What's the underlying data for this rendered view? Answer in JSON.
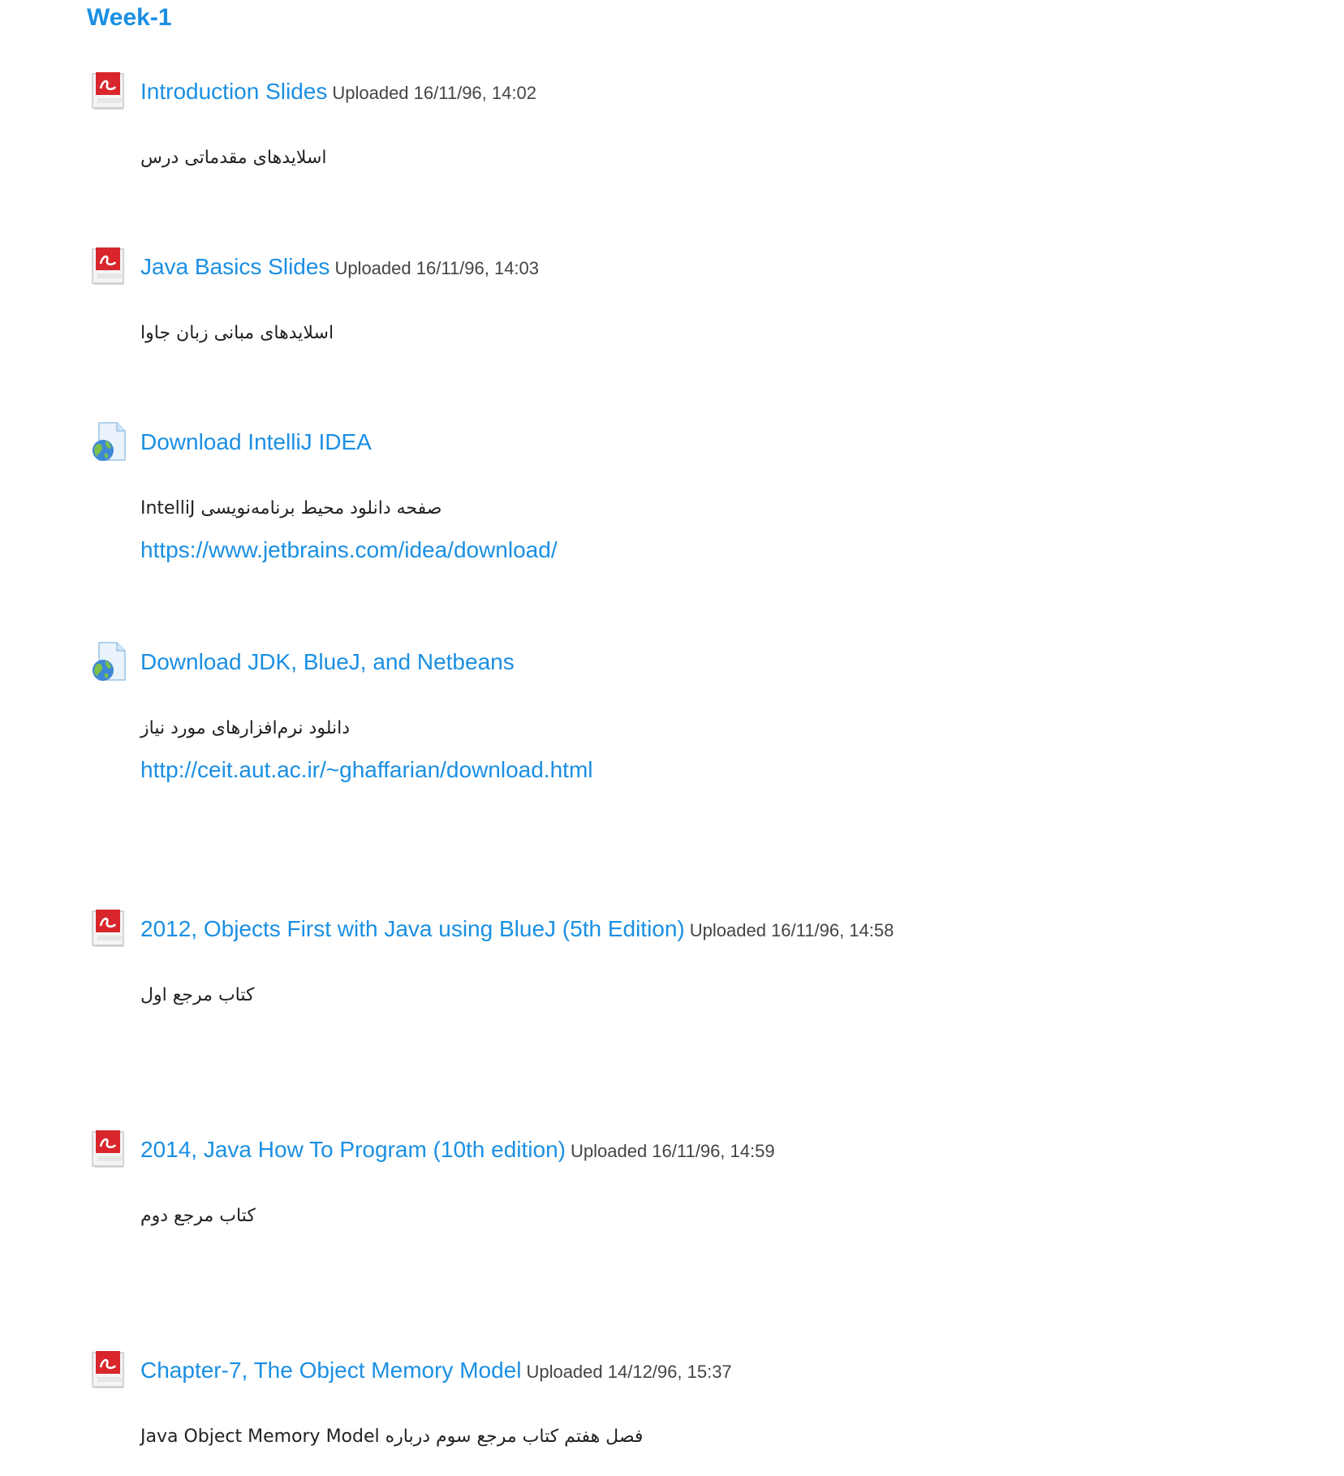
{
  "section": {
    "title": "Week-1"
  },
  "activities": [
    {
      "type": "pdf",
      "icon": "pdf-icon",
      "title": "Introduction Slides",
      "meta": "Uploaded 16/11/96, 14:02",
      "description": "اسلایدهای مقدماتی درس"
    },
    {
      "type": "pdf",
      "icon": "pdf-icon",
      "title": "Java Basics Slides",
      "meta": "Uploaded 16/11/96, 14:03",
      "description": "اسلایدهای مبانی زبان جاوا"
    },
    {
      "type": "url",
      "icon": "web-link-icon",
      "title": "Download IntelliJ IDEA",
      "description": "صفحه دانلود محیط برنامه‌نویسی IntelliJ",
      "url": "https://www.jetbrains.com/idea/download/"
    },
    {
      "type": "url",
      "icon": "web-link-icon",
      "title": "Download JDK, BlueJ, and Netbeans",
      "description": "دانلود نرم‌افزارهای مورد نیاز",
      "url": "http://ceit.aut.ac.ir/~ghaffarian/download.html"
    },
    {
      "type": "pdf",
      "icon": "pdf-icon",
      "title": "2012, Objects First with Java using BlueJ (5th Edition)",
      "meta": "Uploaded 16/11/96, 14:58",
      "description": "کتاب مرجع اول"
    },
    {
      "type": "pdf",
      "icon": "pdf-icon",
      "title": "2014, Java How To Program (10th edition)",
      "meta": "Uploaded 16/11/96, 14:59",
      "description": "کتاب مرجع دوم"
    },
    {
      "type": "pdf",
      "icon": "pdf-icon",
      "title": "Chapter-7, The Object Memory Model",
      "meta": "Uploaded 14/12/96, 15:37",
      "description": "فصل هفتم کتاب مرجع سوم درباره Java Object Memory Model"
    }
  ],
  "colors": {
    "link": "#1a8fe3",
    "text": "#222222",
    "meta": "#444444",
    "pdf_red": "#d8262c"
  }
}
